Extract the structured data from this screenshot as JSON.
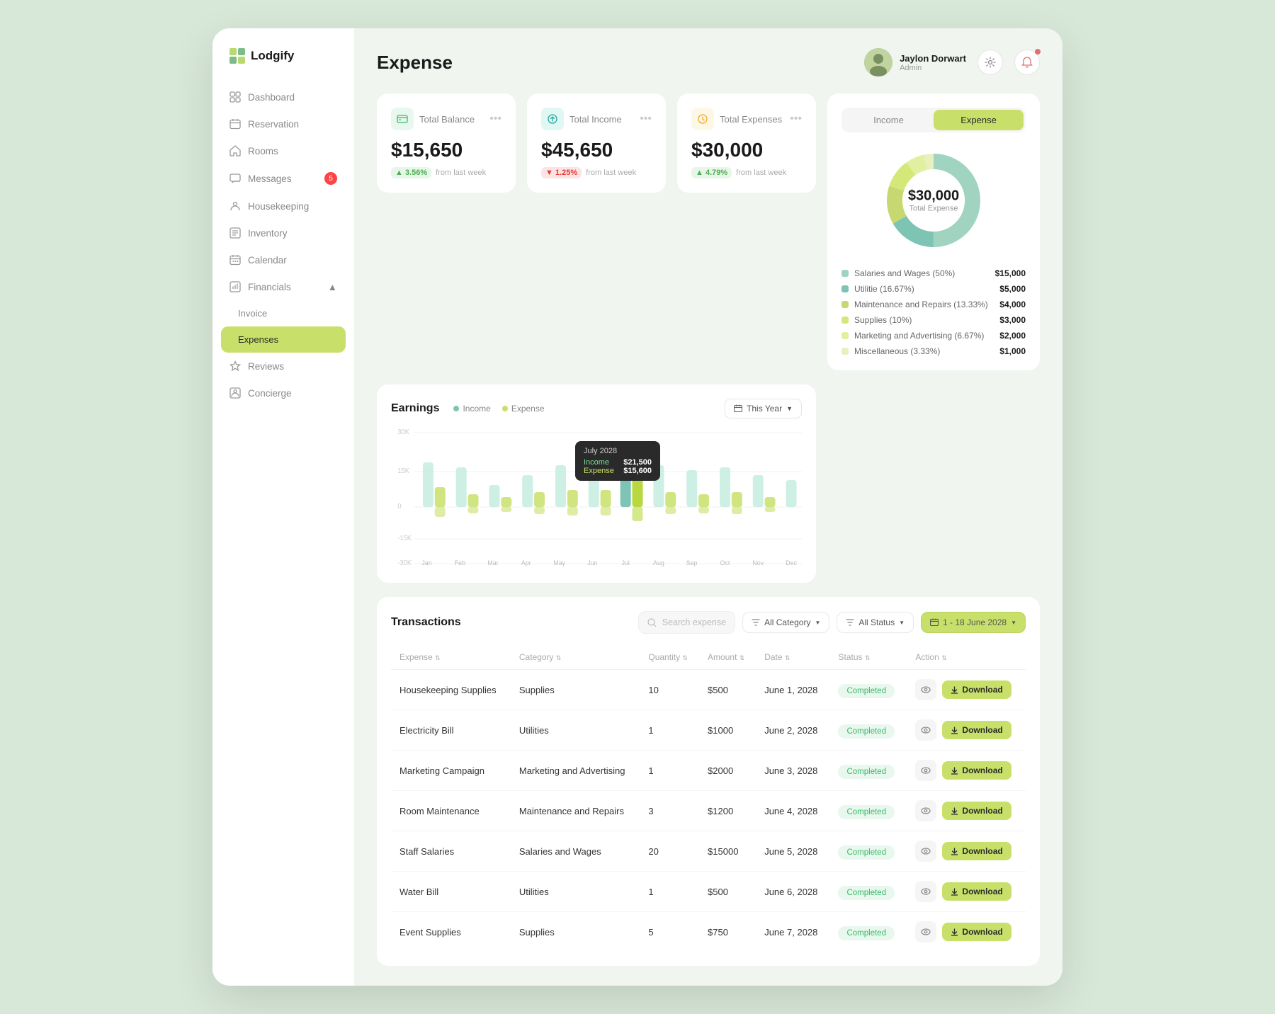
{
  "app": {
    "logo_text": "Lodgify",
    "page_title": "Expense"
  },
  "sidebar": {
    "items": [
      {
        "id": "dashboard",
        "label": "Dashboard",
        "icon": "grid-icon",
        "active": false,
        "badge": null
      },
      {
        "id": "reservation",
        "label": "Reservation",
        "icon": "calendar-icon",
        "active": false,
        "badge": null
      },
      {
        "id": "rooms",
        "label": "Rooms",
        "icon": "home-icon",
        "active": false,
        "badge": null
      },
      {
        "id": "messages",
        "label": "Messages",
        "icon": "message-icon",
        "active": false,
        "badge": "5"
      },
      {
        "id": "housekeeping",
        "label": "Housekeeping",
        "icon": "housekeeping-icon",
        "active": false,
        "badge": null
      },
      {
        "id": "inventory",
        "label": "Inventory",
        "icon": "inventory-icon",
        "active": false,
        "badge": null
      },
      {
        "id": "calendar",
        "label": "Calendar",
        "icon": "cal-icon",
        "active": false,
        "badge": null
      },
      {
        "id": "financials",
        "label": "Financials",
        "icon": "financials-icon",
        "active": false,
        "badge": null
      },
      {
        "id": "invoice",
        "label": "Invoice",
        "icon": null,
        "active": false,
        "sub": true
      },
      {
        "id": "expenses",
        "label": "Expenses",
        "icon": null,
        "active": true,
        "sub": true
      },
      {
        "id": "reviews",
        "label": "Reviews",
        "icon": "reviews-icon",
        "active": false,
        "badge": null
      },
      {
        "id": "concierge",
        "label": "Concierge",
        "icon": "concierge-icon",
        "active": false,
        "badge": null
      }
    ]
  },
  "user": {
    "name": "Jaylon Dorwart",
    "role": "Admin"
  },
  "summary_cards": [
    {
      "id": "total-balance",
      "title": "Total Balance",
      "amount": "$15,650",
      "change": "3.56%",
      "change_direction": "up",
      "change_label": "from last week",
      "icon": "balance-icon"
    },
    {
      "id": "total-income",
      "title": "Total Income",
      "amount": "$45,650",
      "change": "1.25%",
      "change_direction": "down",
      "change_label": "from last week",
      "icon": "income-icon"
    },
    {
      "id": "total-expenses",
      "title": "Total Expenses",
      "amount": "$30,000",
      "change": "4.79%",
      "change_direction": "up",
      "change_label": "from last week",
      "icon": "expenses-icon"
    }
  ],
  "earnings": {
    "title": "Earnings",
    "legend_income": "Income",
    "legend_expense": "Expense",
    "year_btn": "This Year",
    "months": [
      "Jan",
      "Feb",
      "Mar",
      "Apr",
      "May",
      "Jun",
      "Jul",
      "Aug",
      "Sep",
      "Oct",
      "Nov",
      "Dec"
    ],
    "income_data": [
      18,
      16,
      9,
      13,
      17,
      19,
      21,
      17,
      15,
      16,
      13,
      11
    ],
    "expense_data": [
      8,
      5,
      4,
      6,
      7,
      7,
      15,
      6,
      5,
      6,
      4,
      3
    ],
    "tooltip": {
      "month": "July 2028",
      "income_label": "Income",
      "income_value": "$21,500",
      "expense_label": "Expense",
      "expense_value": "$15,600"
    }
  },
  "expense_chart": {
    "tabs": [
      "Income",
      "Expense"
    ],
    "active_tab": "Expense",
    "donut_amount": "$30,000",
    "donut_label": "Total Expense",
    "segments": [
      {
        "label": "Salaries and Wages",
        "percent": "50%",
        "value": "$15,000",
        "color": "#a0d4c0"
      },
      {
        "label": "Utilitie",
        "percent": "16.67%",
        "value": "$5,000",
        "color": "#7dc4b4"
      },
      {
        "label": "Maintenance and Repairs",
        "percent": "13.33%",
        "value": "$4,000",
        "color": "#c8d870"
      },
      {
        "label": "Supplies",
        "percent": "10%",
        "value": "$3,000",
        "color": "#d4e87a"
      },
      {
        "label": "Marketing and Advertising",
        "percent": "6.67%",
        "value": "$2,000",
        "color": "#e0f0a0"
      },
      {
        "label": "Miscellaneous",
        "percent": "3.33%",
        "value": "$1,000",
        "color": "#e8f0c0"
      }
    ]
  },
  "transactions": {
    "title": "Transactions",
    "search_placeholder": "Search expense",
    "filters": {
      "category": "All Category",
      "status": "All Status",
      "date_range": "1 - 18 June 2028"
    },
    "columns": [
      "Expense",
      "Category",
      "Quantity",
      "Amount",
      "Date",
      "Status",
      "Action"
    ],
    "rows": [
      {
        "expense": "Housekeeping Supplies",
        "category": "Supplies",
        "quantity": "10",
        "amount": "$500",
        "date": "June 1, 2028",
        "status": "Completed"
      },
      {
        "expense": "Electricity Bill",
        "category": "Utilities",
        "quantity": "1",
        "amount": "$1000",
        "date": "June 2, 2028",
        "status": "Completed"
      },
      {
        "expense": "Marketing Campaign",
        "category": "Marketing and Advertising",
        "quantity": "1",
        "amount": "$2000",
        "date": "June 3, 2028",
        "status": "Completed"
      },
      {
        "expense": "Room Maintenance",
        "category": "Maintenance and Repairs",
        "quantity": "3",
        "amount": "$1200",
        "date": "June 4, 2028",
        "status": "Completed"
      },
      {
        "expense": "Staff Salaries",
        "category": "Salaries and Wages",
        "quantity": "20",
        "amount": "$15000",
        "date": "June 5, 2028",
        "status": "Completed"
      },
      {
        "expense": "Water Bill",
        "category": "Utilities",
        "quantity": "1",
        "amount": "$500",
        "date": "June 6, 2028",
        "status": "Completed"
      },
      {
        "expense": "Event Supplies",
        "category": "Supplies",
        "quantity": "5",
        "amount": "$750",
        "date": "June 7, 2028",
        "status": "Completed"
      }
    ],
    "action_download": "Download"
  }
}
